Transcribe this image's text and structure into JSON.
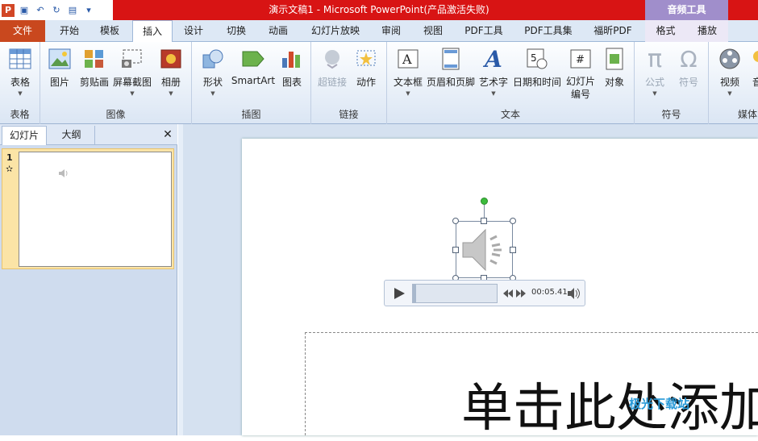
{
  "window": {
    "title": "演示文稿1 - Microsoft PowerPoint(产品激活失败)",
    "context_group": "音频工具",
    "accent_color": "#d81414"
  },
  "quick_access": [
    {
      "name": "powerpoint-logo-icon",
      "glyph": "P"
    },
    {
      "name": "save-icon",
      "glyph": "▣"
    },
    {
      "name": "undo-icon",
      "glyph": "↶"
    },
    {
      "name": "redo-icon",
      "glyph": "↻"
    },
    {
      "name": "layout-icon",
      "glyph": "▤"
    },
    {
      "name": "customize-qat-icon",
      "glyph": "▾"
    }
  ],
  "tabs": {
    "file": "文件",
    "home": "开始",
    "template": "模板",
    "insert": "插入",
    "design": "设计",
    "transition": "切换",
    "animation": "动画",
    "slideshow": "幻灯片放映",
    "review": "审阅",
    "view": "视图",
    "pdf_tools": "PDF工具",
    "pdf_toolset": "PDF工具集",
    "foxit_pdf": "福昕PDF",
    "format": "格式",
    "playback": "播放"
  },
  "ribbon": {
    "group_table": "表格",
    "group_images": "图像",
    "group_illustrations": "插图",
    "group_links": "链接",
    "group_text": "文本",
    "group_symbols": "符号",
    "group_media": "媒体",
    "btn_table": "表格",
    "btn_picture": "图片",
    "btn_clipart": "剪贴画",
    "btn_screenshot": "屏幕截图",
    "btn_album": "相册",
    "btn_shapes": "形状",
    "btn_smartart": "SmartArt",
    "btn_chart": "图表",
    "btn_hyperlink": "超链接",
    "btn_action": "动作",
    "btn_textbox": "文本框",
    "btn_header": "页眉和页脚",
    "btn_wordart": "艺术字",
    "btn_datetime": "日期和时间",
    "btn_slidenum_1": "幻灯片",
    "btn_slidenum_2": "编号",
    "btn_object": "对象",
    "btn_equation": "公式",
    "btn_symbol": "符号",
    "btn_video": "视频",
    "btn_audio_partial": "音"
  },
  "left_pane": {
    "tab_slides": "幻灯片",
    "tab_outline": "大纲",
    "close": "✕",
    "slide_number": "1",
    "slide_star": "✫"
  },
  "player": {
    "time": "00:05.41",
    "progress": 0.0
  },
  "slide": {
    "placeholder_text": "单击此处添加"
  },
  "watermark": "极光下载站"
}
